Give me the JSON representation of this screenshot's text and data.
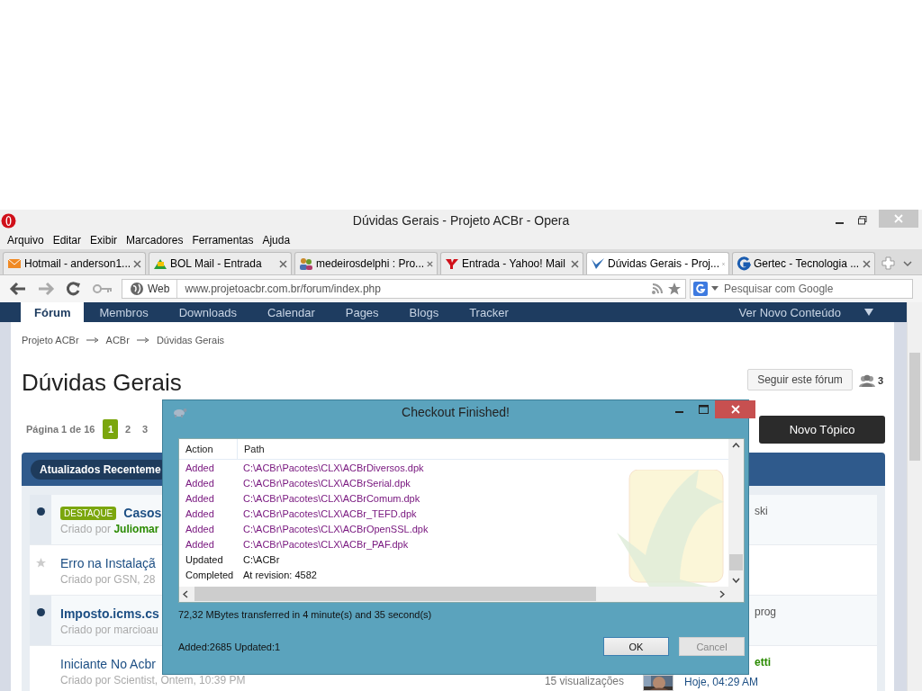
{
  "browser": {
    "title": "Dúvidas Gerais - Projeto ACBr - Opera",
    "menu": [
      "Arquivo",
      "Editar",
      "Exibir",
      "Marcadores",
      "Ferramentas",
      "Ajuda"
    ],
    "tabs": [
      {
        "label": "Hotmail - anderson1...",
        "selected": false
      },
      {
        "label": "BOL Mail - Entrada",
        "selected": false
      },
      {
        "label": "medeirosdelphi : Pro...",
        "selected": false
      },
      {
        "label": "Entrada - Yahoo! Mail",
        "selected": false
      },
      {
        "label": "Dúvidas Gerais - Proj...",
        "selected": true
      },
      {
        "label": "Gertec - Tecnologia ...",
        "selected": false
      }
    ],
    "address": {
      "scope": "Web",
      "url": "www.projetoacbr.com.br/forum/index.php"
    },
    "search": {
      "placeholder": "Pesquisar com Google"
    }
  },
  "forum": {
    "nav": [
      {
        "label": "Fórum",
        "selected": true
      },
      {
        "label": "Membros",
        "selected": false
      },
      {
        "label": "Downloads",
        "selected": false
      },
      {
        "label": "Calendar",
        "selected": false
      },
      {
        "label": "Pages",
        "selected": false
      },
      {
        "label": "Blogs",
        "selected": false
      },
      {
        "label": "Tracker",
        "selected": false
      }
    ],
    "nav_right": "Ver Novo Conteúdo",
    "breadcrumb": [
      "Projeto ACBr",
      "ACBr",
      "Dúvidas Gerais"
    ],
    "title": "Dúvidas Gerais",
    "follow_button": "Seguir este fórum",
    "followers": "3",
    "pagination": {
      "label": "Página 1 de 16",
      "pages": [
        {
          "label": "1",
          "selected": true
        },
        {
          "label": "2",
          "selected": false
        },
        {
          "label": "3",
          "selected": false
        }
      ]
    },
    "new_topic_button": "Novo Tópico",
    "filter_tab": "Atualizados Recenteme",
    "topics": [
      {
        "unread": true,
        "starred": false,
        "badge": "DESTAQUE",
        "title": "Casos",
        "byline": "Criado por **Juliomar**",
        "last_poster": "ski"
      },
      {
        "unread": false,
        "starred": true,
        "title": "Erro na Instalaçã",
        "byline": "Criado por GSN, 28"
      },
      {
        "unread": true,
        "starred": false,
        "title": "Imposto.icms.cs",
        "byline": "Criado por marcioau",
        "last_poster": "prog"
      },
      {
        "unread": false,
        "starred": false,
        "title": "Iniciante No Acbr",
        "byline": "Criado por Scientist, Ontem, 10:39 PM",
        "views": "15 visualizações",
        "last_poster": "**etti**",
        "last_post_time": "Hoje, 04:29 AM"
      }
    ]
  },
  "dialog": {
    "title": "Checkout Finished!",
    "columns": [
      "Action",
      "Path"
    ],
    "rows": [
      {
        "kind": "added",
        "action": "Added",
        "path": "C:\\ACBr\\Pacotes\\CLX\\ACBrDiversos.dpk"
      },
      {
        "kind": "added",
        "action": "Added",
        "path": "C:\\ACBr\\Pacotes\\CLX\\ACBrSerial.dpk"
      },
      {
        "kind": "added",
        "action": "Added",
        "path": "C:\\ACBr\\Pacotes\\CLX\\ACBrComum.dpk"
      },
      {
        "kind": "added",
        "action": "Added",
        "path": "C:\\ACBr\\Pacotes\\CLX\\ACBr_TEFD.dpk"
      },
      {
        "kind": "added",
        "action": "Added",
        "path": "C:\\ACBr\\Pacotes\\CLX\\ACBrOpenSSL.dpk"
      },
      {
        "kind": "added",
        "action": "Added",
        "path": "C:\\ACBr\\Pacotes\\CLX\\ACBr_PAF.dpk"
      },
      {
        "kind": "updated",
        "action": "Updated",
        "path": "C:\\ACBr"
      },
      {
        "kind": "completed",
        "action": "Completed",
        "path": "At revision: 4582"
      }
    ],
    "summary": "72,32 MBytes transferred in 4 minute(s) and 35 second(s)",
    "counts": "Added:2685 Updated:1",
    "buttons": [
      {
        "label": "OK",
        "focused": true,
        "disabled": false
      },
      {
        "label": "Cancel",
        "focused": false,
        "disabled": true
      }
    ]
  }
}
